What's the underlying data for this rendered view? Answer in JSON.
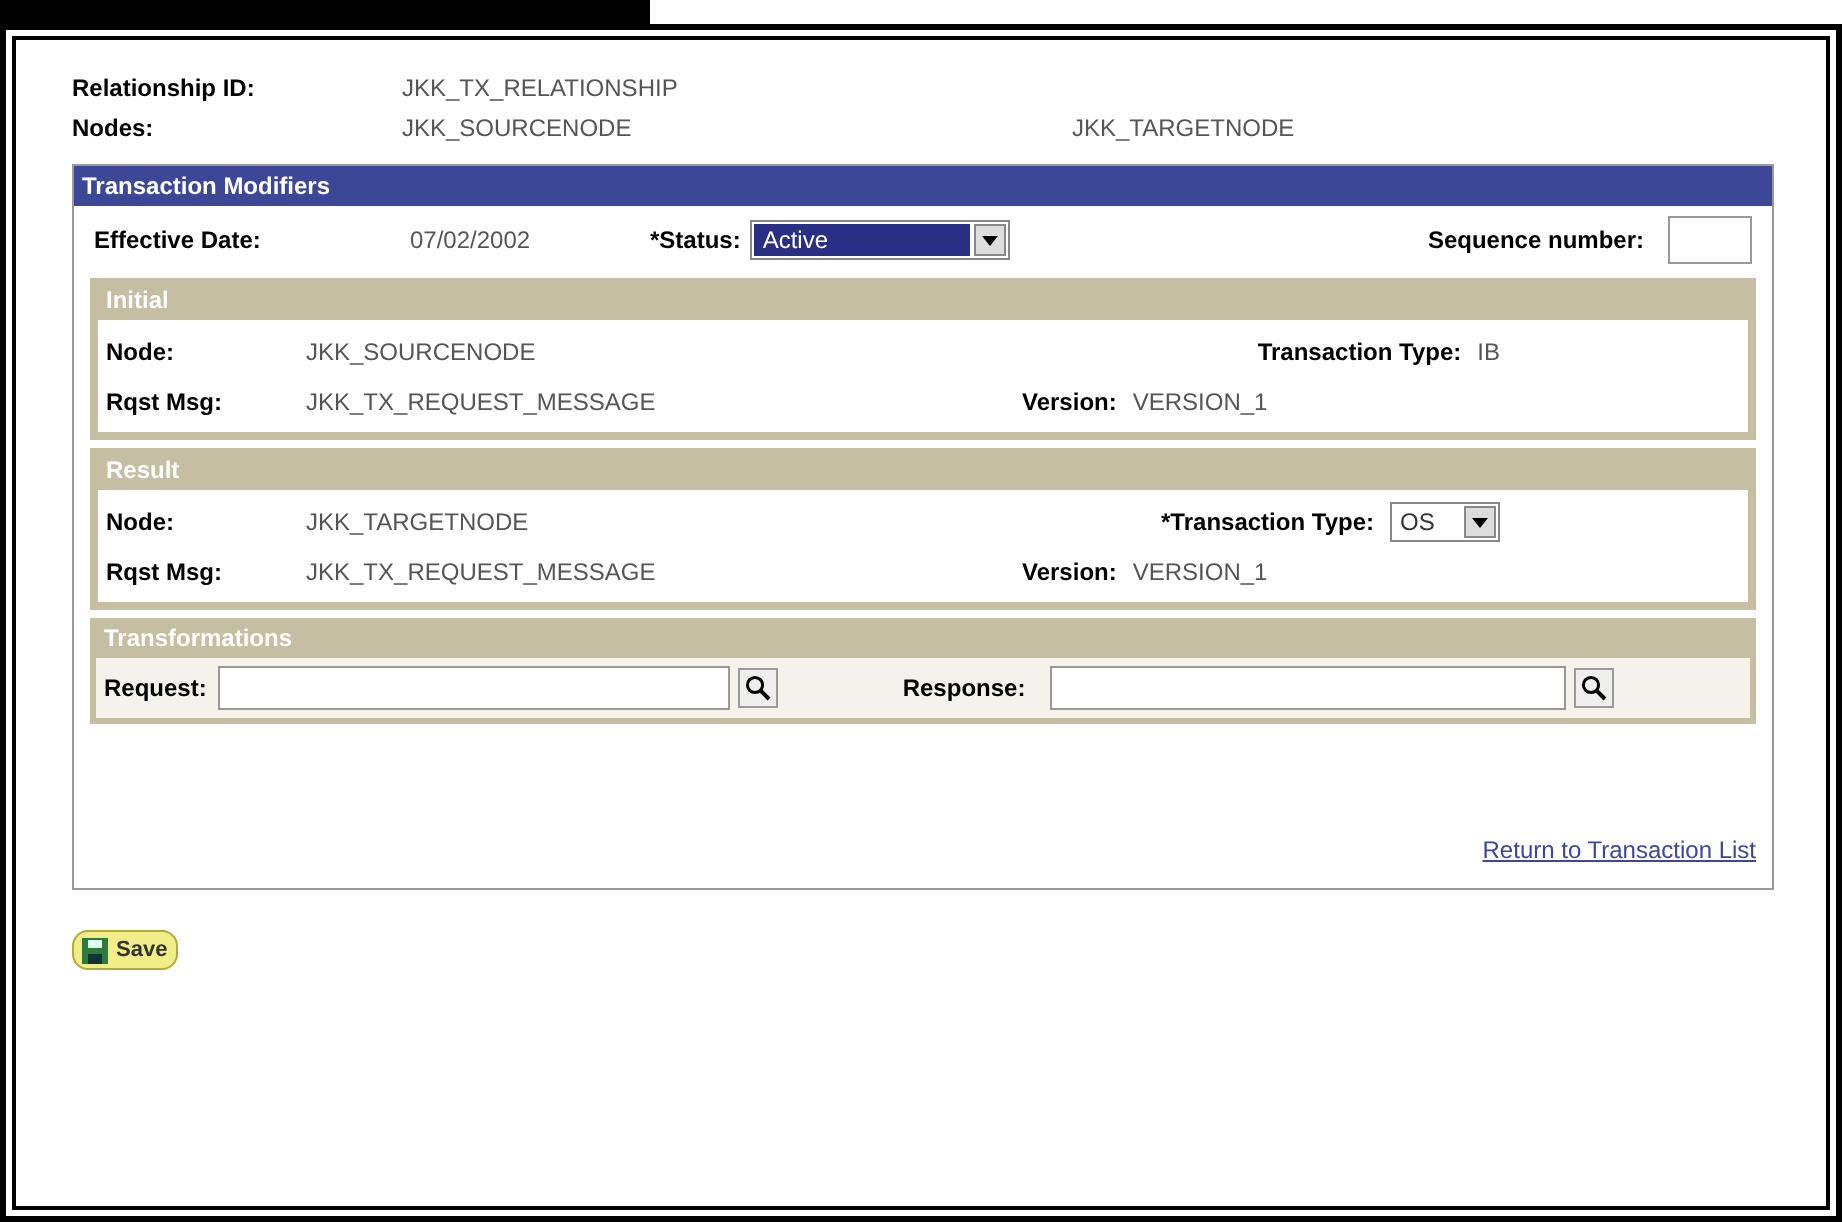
{
  "header": {
    "relationship_id": {
      "label": "Relationship ID:",
      "value": "JKK_TX_RELATIONSHIP"
    },
    "nodes": {
      "label": "Nodes:",
      "source": "JKK_SOURCENODE",
      "target": "JKK_TARGETNODE"
    }
  },
  "transaction_modifiers": {
    "title": "Transaction Modifiers",
    "effective_date": {
      "label": "Effective Date:",
      "value": "07/02/2002"
    },
    "status": {
      "label": "*Status:",
      "value": "Active"
    },
    "sequence_number": {
      "label": "Sequence number:"
    }
  },
  "initial": {
    "title": "Initial",
    "node": {
      "label": "Node:",
      "value": "JKK_SOURCENODE"
    },
    "rqst_msg": {
      "label": "Rqst Msg:",
      "value": "JKK_TX_REQUEST_MESSAGE"
    },
    "transaction_type": {
      "label": "Transaction Type:",
      "value": "IB",
      "kind": "text"
    },
    "version": {
      "label": "Version:",
      "value": "VERSION_1"
    }
  },
  "result": {
    "title": "Result",
    "node": {
      "label": "Node:",
      "value": "JKK_TARGETNODE"
    },
    "rqst_msg": {
      "label": "Rqst Msg:",
      "value": "JKK_TX_REQUEST_MESSAGE"
    },
    "transaction_type": {
      "label": "*Transaction Type:",
      "value": "OS",
      "kind": "select"
    },
    "version": {
      "label": "Version:",
      "value": "VERSION_1"
    }
  },
  "transformations": {
    "title": "Transformations",
    "request": {
      "label": "Request:"
    },
    "response": {
      "label": "Response:"
    }
  },
  "return_link": "Return to Transaction List",
  "save_button": "Save"
}
